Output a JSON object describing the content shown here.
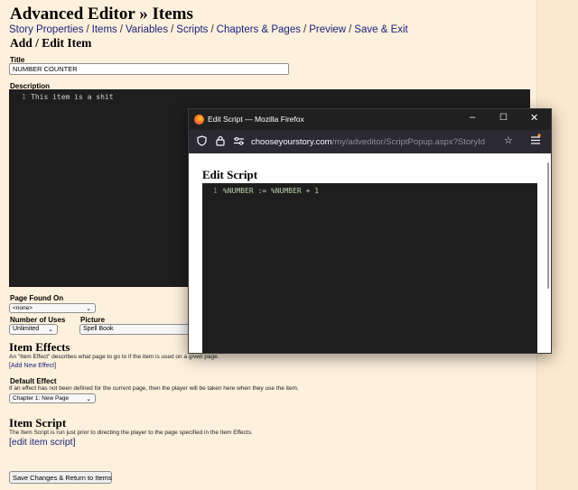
{
  "page": {
    "title": "Advanced Editor » Items",
    "nav": [
      "Story Properties",
      "Items",
      "Variables",
      "Scripts",
      "Chapters & Pages",
      "Preview",
      "Save & Exit"
    ],
    "nav_separator": "/",
    "subtitle": "Add / Edit Item",
    "title_label": "Title",
    "title_value": "NUMBER COUNTER",
    "description_label": "Description",
    "description_line_no": "1",
    "description_code": "This item is a shit",
    "page_found_on_label": "Page Found On",
    "page_found_on_value": "<none>",
    "number_of_uses_label": "Number of Uses",
    "number_of_uses_value": "Unlimited",
    "picture_label": "Picture",
    "picture_value": "Spell Book",
    "item_effects_heading": "Item Effects",
    "item_effects_desc": "An \"Item Effect\" describes what page to go to if the item is used on a given page.",
    "add_new_effect": "[Add New Effect]",
    "default_effect_label": "Default Effect",
    "default_effect_desc": "If an effect has not been defined for the current page, then the player will be taken here when they use the item.",
    "default_effect_value": "Chapter 1: New Page",
    "item_script_heading": "Item Script",
    "item_script_desc": "The Item Script is run just prior to directing the player to the page specified in the Item Effects.",
    "edit_item_script": "[edit item script]",
    "save_button": "Save Changes & Return to Items"
  },
  "popup": {
    "window_title": "Edit Script — Mozilla Firefox",
    "url_domain": "chooseyourstory.com",
    "url_path": "/my/adveditor/ScriptPopup.aspx?StoryId",
    "heading": "Edit Script",
    "line_no": "1",
    "code": {
      "var1": "%NUMBER",
      "op1": ":=",
      "var2": "%NUMBER",
      "op2": "+",
      "num": "1"
    }
  },
  "icons": {
    "minimize": "minimize-icon",
    "maximize": "maximize-icon",
    "close": "close-icon",
    "shield": "shield-icon",
    "lock": "lock-icon",
    "permissions": "permissions-icon",
    "bookmark": "bookmark-star-icon",
    "menu": "menu-icon",
    "chevron": "chevron-down-icon"
  },
  "colors": {
    "page_bg": "#fdf0dc",
    "link": "#1a237e",
    "editor_bg": "#1e1e1e",
    "code_var": "#b5cea8",
    "code_num": "#b5cea8"
  }
}
